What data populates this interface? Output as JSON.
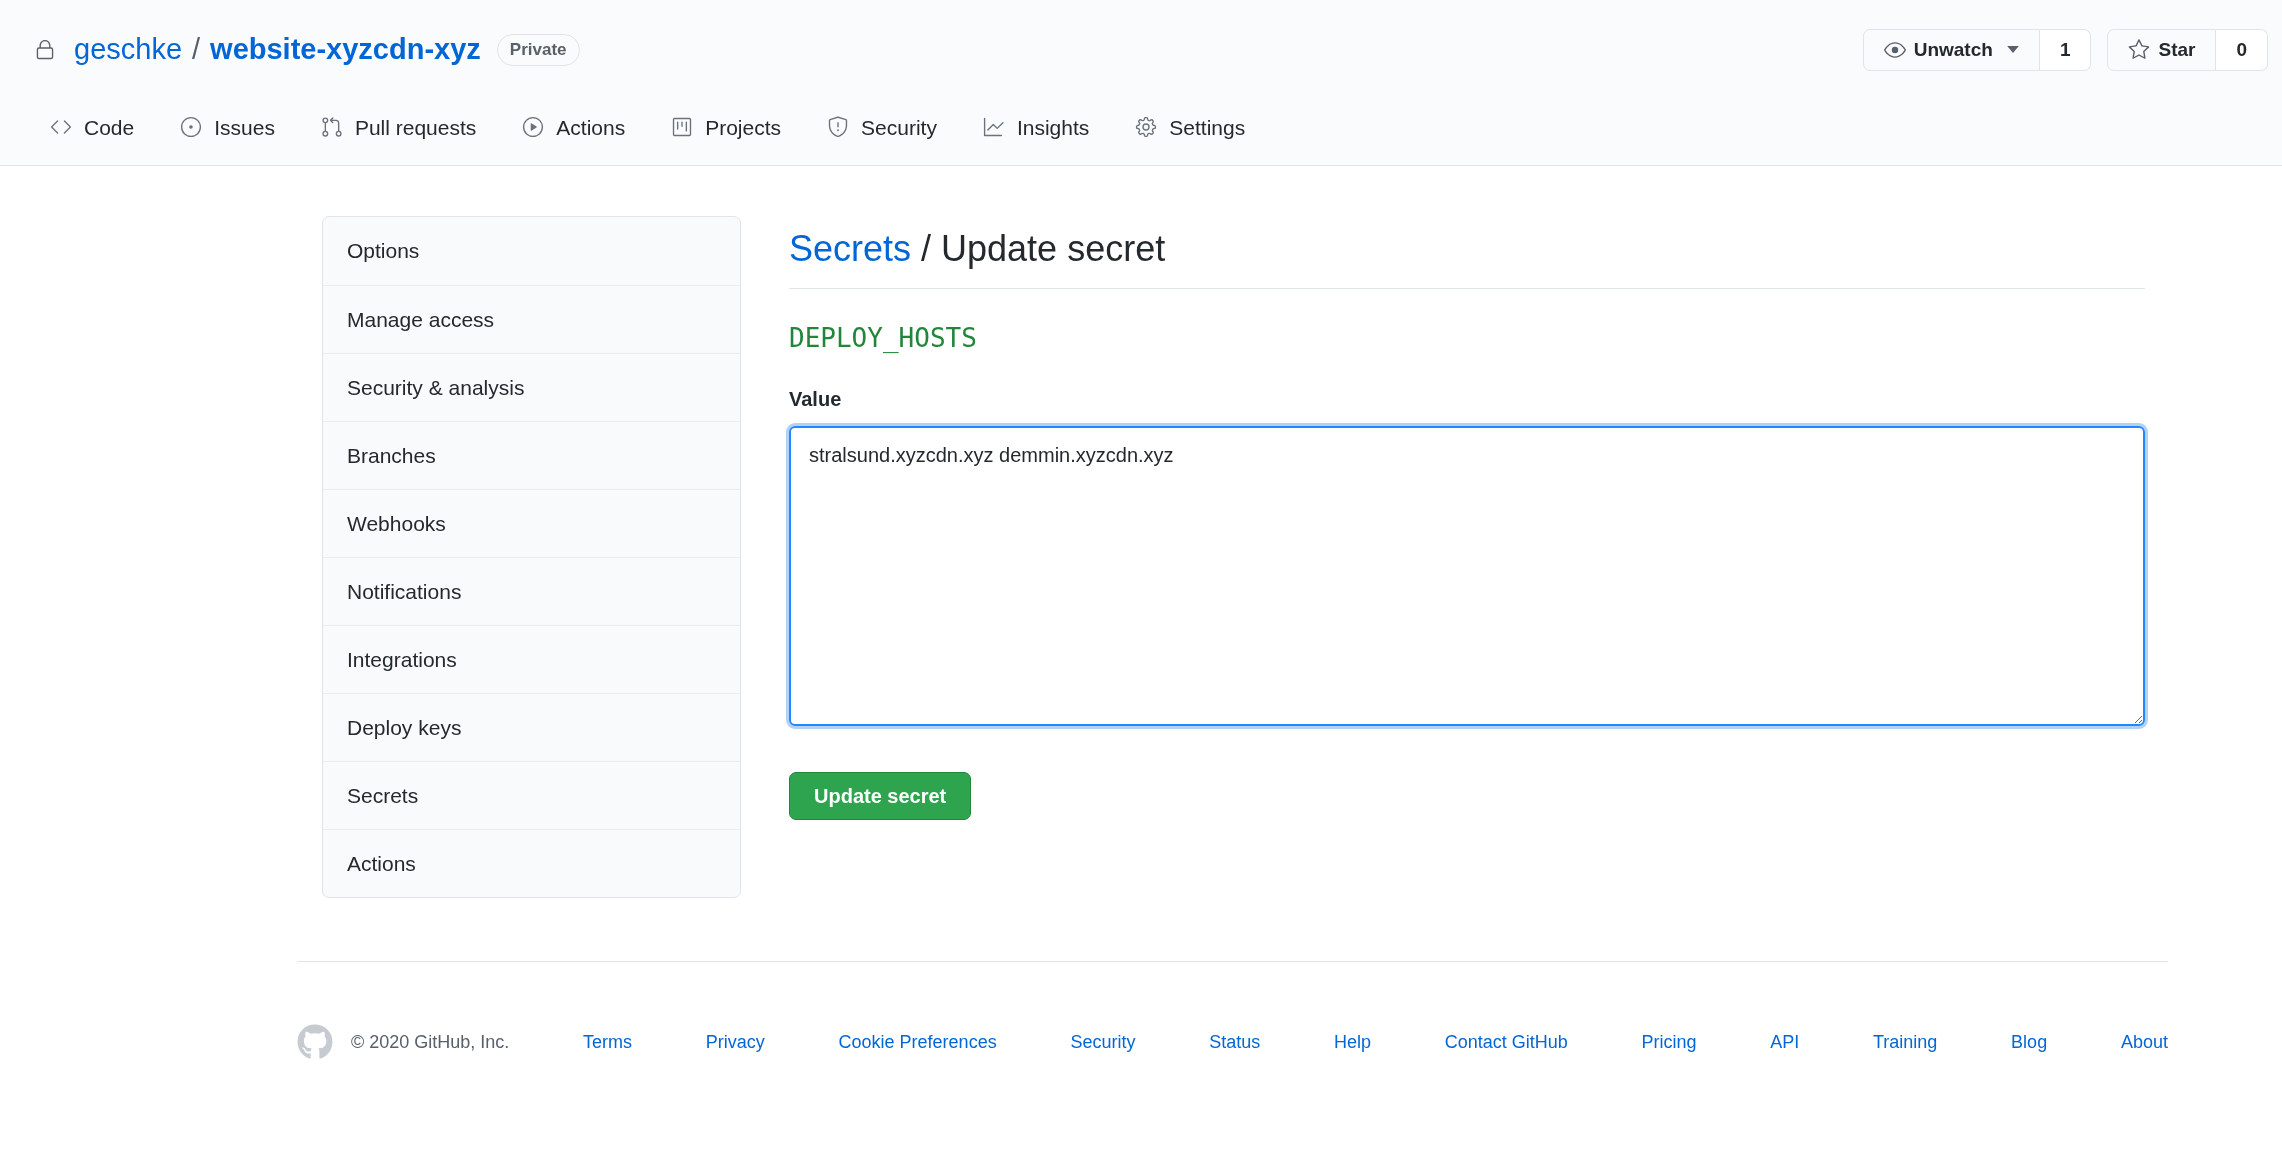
{
  "repo": {
    "owner": "geschke",
    "separator": "/",
    "name": "website-xyzcdn-xyz",
    "badge": "Private"
  },
  "actions": [
    {
      "label": "Unwatch",
      "count": "1"
    },
    {
      "label": "Star",
      "count": "0"
    }
  ],
  "tabs": [
    {
      "label": "Code"
    },
    {
      "label": "Issues"
    },
    {
      "label": "Pull requests"
    },
    {
      "label": "Actions"
    },
    {
      "label": "Projects"
    },
    {
      "label": "Security"
    },
    {
      "label": "Insights"
    },
    {
      "label": "Settings"
    }
  ],
  "sidebar": {
    "items": [
      "Options",
      "Manage access",
      "Security & analysis",
      "Branches",
      "Webhooks",
      "Notifications",
      "Integrations",
      "Deploy keys",
      "Secrets",
      "Actions"
    ]
  },
  "main": {
    "breadcrumb_link": "Secrets",
    "title": "/ Update secret",
    "secret_name": "DEPLOY_HOSTS",
    "field_label": "Value",
    "value": "stralsund.xyzcdn.xyz demmin.xyzcdn.xyz",
    "button": "Update secret"
  },
  "footer": {
    "copyright": "© 2020 GitHub, Inc.",
    "links": [
      "Terms",
      "Privacy",
      "Cookie Preferences",
      "Security",
      "Status",
      "Help",
      "Contact GitHub",
      "Pricing",
      "API",
      "Training",
      "Blog",
      "About"
    ]
  }
}
